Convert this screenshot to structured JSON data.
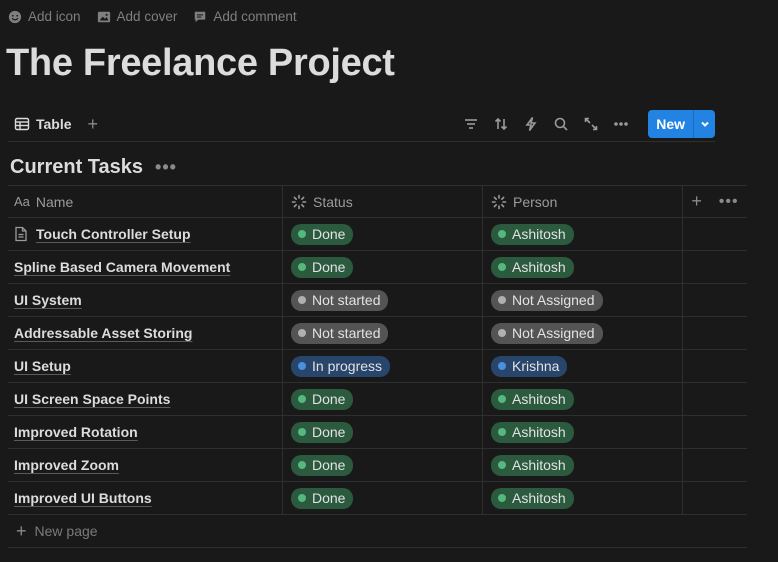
{
  "top_actions": {
    "add_icon": "Add icon",
    "add_cover": "Add cover",
    "add_comment": "Add comment"
  },
  "page": {
    "title": "The Freelance Project"
  },
  "viewbar": {
    "tab_label": "Table",
    "new_label": "New"
  },
  "database": {
    "title": "Current Tasks",
    "columns": {
      "name_prefix": "Aa",
      "name": "Name",
      "status": "Status",
      "person": "Person"
    },
    "rows": [
      {
        "name": "Touch Controller Setup",
        "status": "Done",
        "person": "Ashitosh"
      },
      {
        "name": "Spline Based Camera Movement",
        "status": "Done",
        "person": "Ashitosh"
      },
      {
        "name": "UI System",
        "status": "Not started",
        "person": "Not Assigned"
      },
      {
        "name": "Addressable Asset Storing",
        "status": "Not started",
        "person": "Not Assigned"
      },
      {
        "name": "UI Setup",
        "status": "In progress",
        "person": "Krishna"
      },
      {
        "name": "UI Screen Space Points",
        "status": "Done",
        "person": "Ashitosh"
      },
      {
        "name": "Improved Rotation",
        "status": "Done",
        "person": "Ashitosh"
      },
      {
        "name": "Improved Zoom",
        "status": "Done",
        "person": "Ashitosh"
      },
      {
        "name": "Improved UI Buttons",
        "status": "Done",
        "person": "Ashitosh"
      }
    ],
    "new_page_label": "New page"
  },
  "colors": {
    "background": "#191919",
    "accent": "#2383e2",
    "done": "#2b5a3e",
    "not_started": "#545454",
    "in_progress": "#28456c"
  }
}
